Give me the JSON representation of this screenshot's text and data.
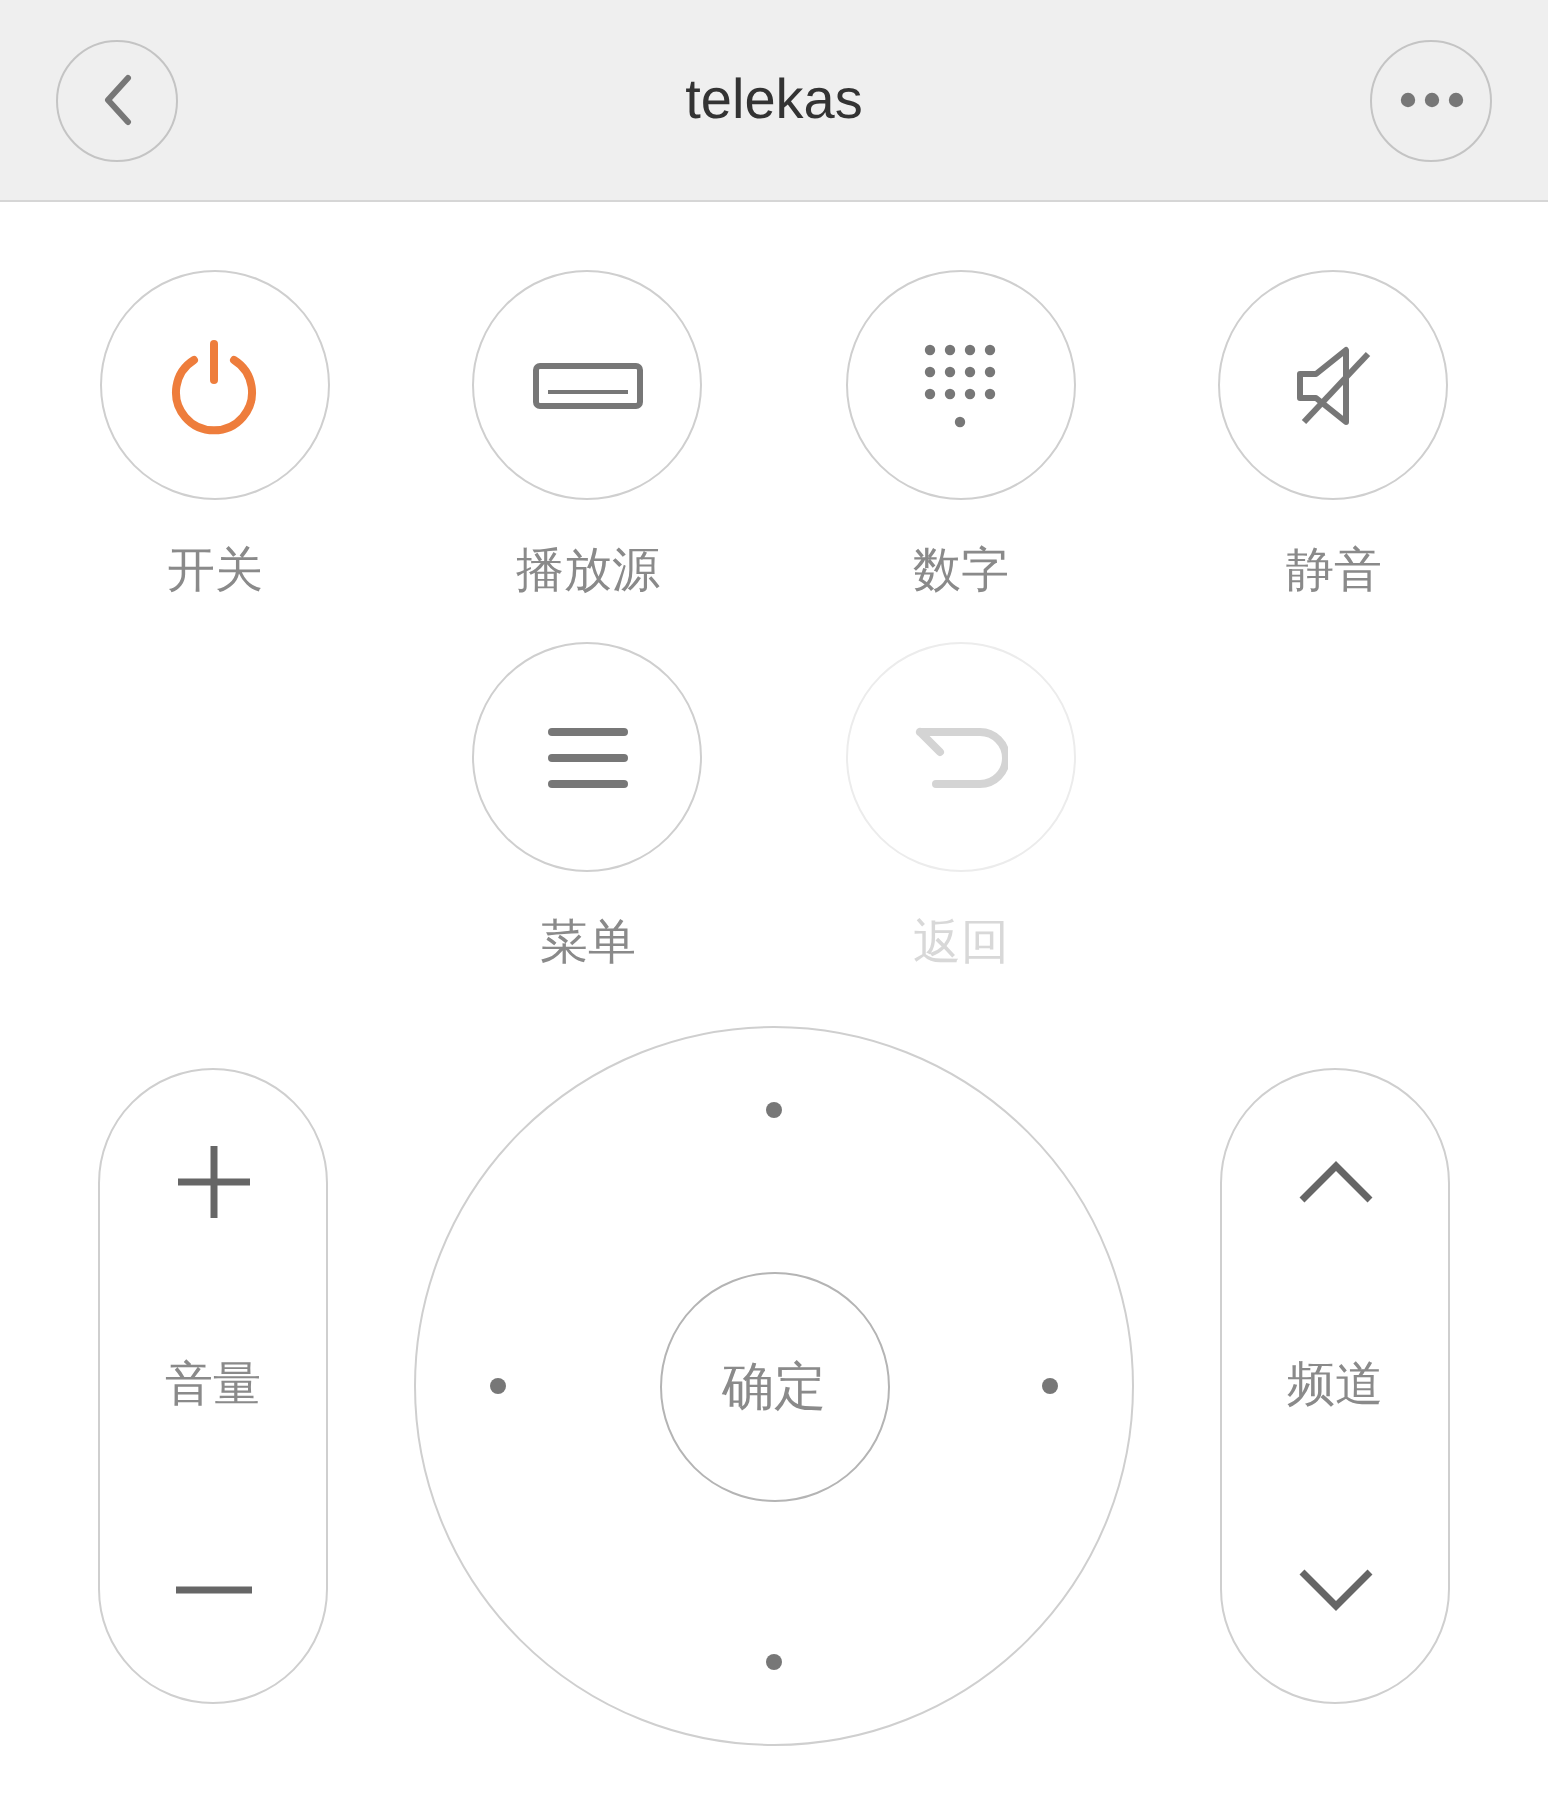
{
  "header": {
    "title": "telekas"
  },
  "buttons": [
    {
      "kind": "power",
      "label": "开关",
      "disabled": false
    },
    {
      "kind": "input",
      "label": "播放源",
      "disabled": false
    },
    {
      "kind": "numpad",
      "label": "数字",
      "disabled": false
    },
    {
      "kind": "mute",
      "label": "静音",
      "disabled": false
    },
    {
      "kind": "menu",
      "label": "菜单",
      "disabled": false
    },
    {
      "kind": "back",
      "label": "返回",
      "disabled": true
    }
  ],
  "volume": {
    "label": "音量"
  },
  "dpad": {
    "ok_label": "确定"
  },
  "channel": {
    "label": "频道"
  }
}
